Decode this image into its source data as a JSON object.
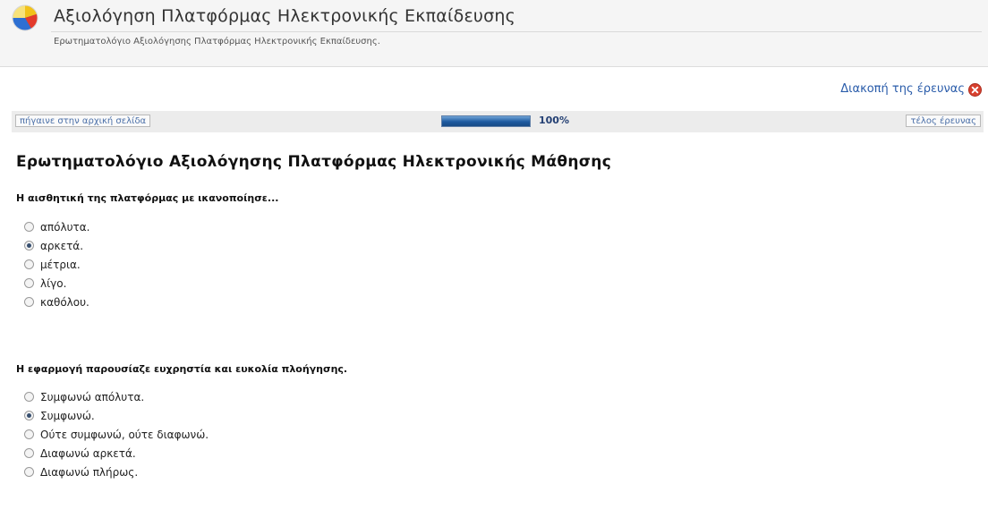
{
  "header": {
    "title": "Αξιολόγηση Πλατφόρμας Ηλεκτρονικής Εκπαίδευσης",
    "subtitle": "Ερωτηματολόγιο Αξιολόγησης Πλατφόρμας Ηλεκτρονικής Εκπαίδευσης.",
    "logo_icon": "pie-chart-icon"
  },
  "stop_survey": {
    "label": "Διακοπή της έρευνας",
    "icon": "close-circle-icon",
    "color": "#2a5caa"
  },
  "navigation": {
    "home_label": "πήγαινε στην αρχική σελίδα",
    "end_label": "τέλος έρευνας",
    "progress_percent": 100,
    "progress_text": "100%"
  },
  "survey": {
    "title": "Ερωτηματολόγιο Αξιολόγησης Πλατφόρμας Ηλεκτρονικής Μάθησης",
    "questions": [
      {
        "text": "Η αισθητική της πλατφόρμας με ικανοποίησε...",
        "options": [
          "απόλυτα.",
          "αρκετά.",
          "μέτρια.",
          "λίγο.",
          "καθόλου."
        ],
        "selected": 1
      },
      {
        "text": "Η εφαρμογή παρουσίαζε ευχρηστία και ευκολία πλοήγησης.",
        "options": [
          "Συμφωνώ απόλυτα.",
          "Συμφωνώ.",
          "Ούτε συμφωνώ, ούτε διαφωνώ.",
          "Διαφωνώ αρκετά.",
          "Διαφωνώ πλήρως."
        ],
        "selected": 1
      }
    ]
  }
}
